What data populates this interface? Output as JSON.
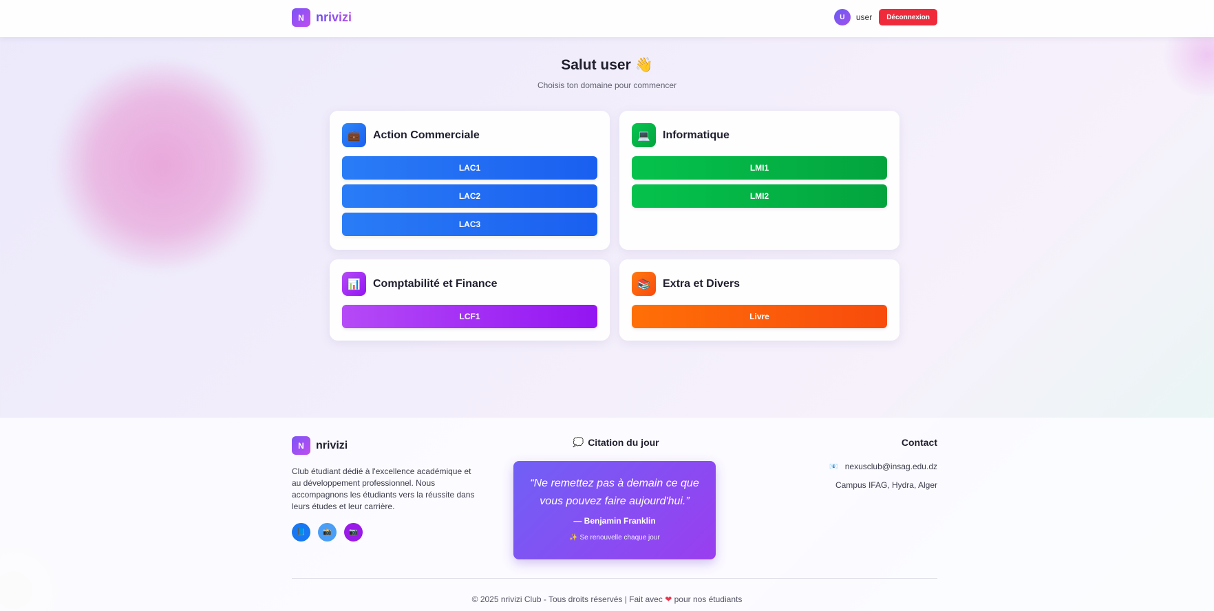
{
  "header": {
    "logo_letter": "N",
    "brand": "nrivizi",
    "user_initial": "U",
    "username": "user",
    "logout_label": "Déconnexion"
  },
  "hero": {
    "title": "Salut user 👋",
    "subtitle": "Choisis ton domaine pour commencer"
  },
  "domains": [
    {
      "title": "Action Commerciale",
      "icon": "briefcase-icon",
      "icon_glyph": "💼",
      "color": "#2a7cf6",
      "levels": [
        "LAC1",
        "LAC2",
        "LAC3"
      ]
    },
    {
      "title": "Informatique",
      "icon": "laptop-icon",
      "icon_glyph": "💻",
      "color": "#05c24c",
      "levels": [
        "LMI1",
        "LMI2"
      ]
    },
    {
      "title": "Comptabilité et Finance",
      "icon": "bar-chart-icon",
      "icon_glyph": "📊",
      "color": "#b54af7",
      "levels": [
        "LCF1"
      ]
    },
    {
      "title": "Extra et Divers",
      "icon": "books-icon",
      "icon_glyph": "📚",
      "color": "#ff6f07",
      "levels": [
        "Livre"
      ]
    }
  ],
  "footer": {
    "logo_letter": "N",
    "brand": "nrivizi",
    "description": "Club étudiant dédié à l'excellence académique et au développement professionnel. Nous accompagnons les étudiants vers la réussite dans leurs études et leur carrière.",
    "socials": [
      {
        "name": "facebook-icon",
        "glyph": "📘",
        "color": "#1877f2"
      },
      {
        "name": "instagram-icon",
        "glyph": "📸",
        "color": "#4a9ef5"
      },
      {
        "name": "camera-icon",
        "glyph": "📷",
        "color": "#9a1ae8"
      }
    ],
    "quote_heading": "Citation du jour",
    "quote_text": "“Ne remettez pas à demain ce que vous pouvez faire aujourd'hui.”",
    "quote_author": "— Benjamin Franklin",
    "quote_note": "✨ Se renouvelle chaque jour",
    "contact_heading": "Contact",
    "contact_email": "nexusclub@insag.edu.dz",
    "contact_address": "Campus IFAG, Hydra, Alger",
    "copyright_prefix": "© 2025 nrivizi Club - Tous droits réservés | Fait avec",
    "copyright_suffix": "pour nos étudiants"
  }
}
